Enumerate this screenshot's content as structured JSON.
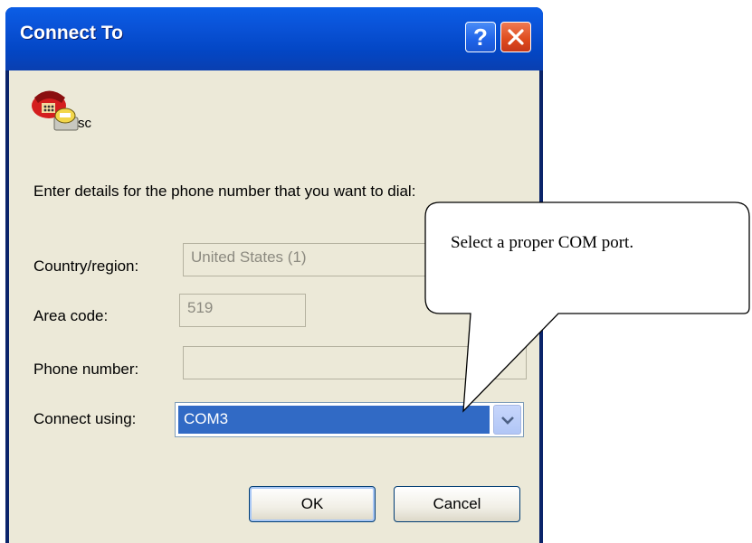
{
  "window": {
    "title": "Connect To",
    "help_glyph": "?",
    "close_glyph": "✕",
    "icons": {
      "help": "help-icon",
      "close": "close-icon",
      "connection": "phone-icon",
      "dropdown": "chevron-down-icon"
    },
    "colors": {
      "titlebar": "#0a53d8",
      "close": "#de4a1c",
      "body": "#ece9d8",
      "selection": "#316ac5"
    }
  },
  "connection": {
    "name": "sc"
  },
  "form": {
    "instructions": "Enter details for the phone number that you want to dial:",
    "country_label": "Country/region:",
    "country_value": "United States (1)",
    "area_label": "Area code:",
    "area_value": "519",
    "phone_label": "Phone number:",
    "phone_value": "",
    "connect_label": "Connect using:",
    "connect_value": "COM3"
  },
  "buttons": {
    "ok": "OK",
    "cancel": "Cancel"
  },
  "callout": {
    "text": "Select a proper COM port."
  }
}
